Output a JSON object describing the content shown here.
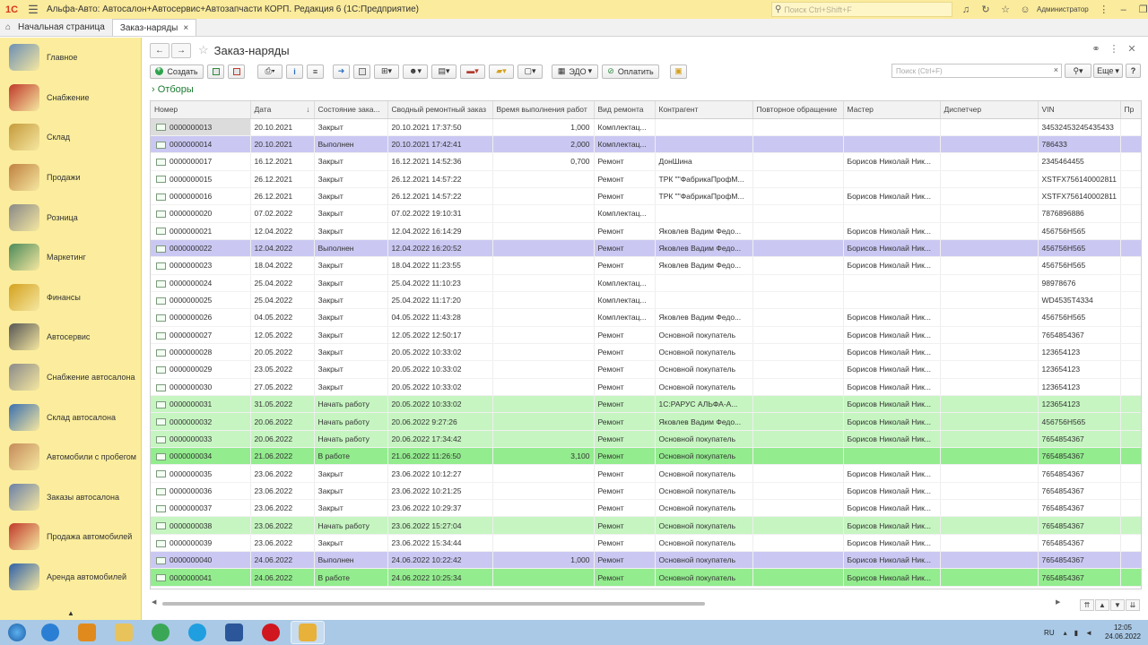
{
  "app": {
    "logo_text": "1С",
    "title": "Альфа-Авто: Автосалон+Автосервис+Автозапчасти КОРП. Редакция 6  (1С:Предприятие)",
    "search_placeholder": "Поиск Ctrl+Shift+F",
    "user": "Администратор"
  },
  "tabs": [
    {
      "label": "Начальная страница"
    },
    {
      "label": "Заказ-наряды",
      "close": "×"
    }
  ],
  "sidebar": {
    "items": [
      {
        "label": "Главное",
        "icon": "main-icon",
        "color": "#6c8fb5"
      },
      {
        "label": "Снабжение",
        "icon": "truck-icon",
        "color": "#c0392b"
      },
      {
        "label": "Склад",
        "icon": "boxes-icon",
        "color": "#c59a3c"
      },
      {
        "label": "Продажи",
        "icon": "sales-icon",
        "color": "#c08040"
      },
      {
        "label": "Розница",
        "icon": "cash-register-icon",
        "color": "#888888"
      },
      {
        "label": "Маркетинг",
        "icon": "chart-icon",
        "color": "#4a8a5a"
      },
      {
        "label": "Финансы",
        "icon": "coins-icon",
        "color": "#d4a11e"
      },
      {
        "label": "Автосервис",
        "icon": "wheel-icon",
        "color": "#555555"
      },
      {
        "label": "Снабжение автосалона",
        "icon": "calculator-icon",
        "color": "#8a8a8a"
      },
      {
        "label": "Склад автосалона",
        "icon": "garage-icon",
        "color": "#3a6fb0"
      },
      {
        "label": "Автомобили с пробегом",
        "icon": "handshake-icon",
        "color": "#c58a5a"
      },
      {
        "label": "Заказы автосалона",
        "icon": "order-icon",
        "color": "#6a7fa8"
      },
      {
        "label": "Продажа автомобилей",
        "icon": "red-car-icon",
        "color": "#c0392b"
      },
      {
        "label": "Аренда автомобилей",
        "icon": "blue-car-icon",
        "color": "#2e5fa8"
      }
    ],
    "collapse": "▲"
  },
  "page": {
    "title": "Заказ-наряды",
    "back": "←",
    "forward": "→",
    "star": "☆"
  },
  "toolbar": {
    "create": "Создать",
    "edo": "ЭДО",
    "pay": "Оплатить",
    "search_placeholder": "Поиск (Ctrl+F)",
    "more": "Еще",
    "help": "?"
  },
  "filters_label": "Отборы",
  "columns": [
    "Номер",
    "Дата",
    "Состояние зака...",
    "Сводный ремонтный заказ",
    "Время выполнения работ",
    "Вид ремонта",
    "Контрагент",
    "Повторное обращение",
    "Мастер",
    "Диспетчер",
    "VIN",
    "Пр"
  ],
  "sort_indicator": "↓",
  "rows": [
    {
      "num": "0000000013",
      "date": "20.10.2021",
      "state": "Закрыт",
      "summary": "20.10.2021 17:37:50",
      "time": "1,000",
      "kind": "Комплектац...",
      "contractor": "",
      "repeat": "",
      "master": "",
      "dispatcher": "",
      "vin": "34532453245435433",
      "status": "closed"
    },
    {
      "num": "0000000014",
      "date": "20.10.2021",
      "state": "Выполнен",
      "summary": "20.10.2021 17:42:41",
      "time": "2,000",
      "kind": "Комплектац...",
      "contractor": "",
      "repeat": "",
      "master": "",
      "dispatcher": "",
      "vin": "786433",
      "status": "done"
    },
    {
      "num": "0000000017",
      "date": "16.12.2021",
      "state": "Закрыт",
      "summary": "16.12.2021 14:52:36",
      "time": "0,700",
      "kind": "Ремонт",
      "contractor": "ДонШина",
      "repeat": "",
      "master": "Борисов Николай Ник...",
      "dispatcher": "",
      "vin": "2345464455",
      "status": "closed"
    },
    {
      "num": "0000000015",
      "date": "26.12.2021",
      "state": "Закрыт",
      "summary": "26.12.2021 14:57:22",
      "time": "",
      "kind": "Ремонт",
      "contractor": "ТРК \"\"ФабрикаПрофМ...",
      "repeat": "",
      "master": "",
      "dispatcher": "",
      "vin": "XSTFX756140002811",
      "status": "closed"
    },
    {
      "num": "0000000016",
      "date": "26.12.2021",
      "state": "Закрыт",
      "summary": "26.12.2021 14:57:22",
      "time": "",
      "kind": "Ремонт",
      "contractor": "ТРК \"\"ФабрикаПрофМ...",
      "repeat": "",
      "master": "Борисов Николай Ник...",
      "dispatcher": "",
      "vin": "XSTFX756140002811",
      "status": "closed"
    },
    {
      "num": "0000000020",
      "date": "07.02.2022",
      "state": "Закрыт",
      "summary": "07.02.2022 19:10:31",
      "time": "",
      "kind": "Комплектац...",
      "contractor": "",
      "repeat": "",
      "master": "",
      "dispatcher": "",
      "vin": "7876896886",
      "status": "closed"
    },
    {
      "num": "0000000021",
      "date": "12.04.2022",
      "state": "Закрыт",
      "summary": "12.04.2022 16:14:29",
      "time": "",
      "kind": "Ремонт",
      "contractor": "Яковлев Вадим Федо...",
      "repeat": "",
      "master": "Борисов Николай Ник...",
      "dispatcher": "",
      "vin": "456756H565",
      "status": "closed"
    },
    {
      "num": "0000000022",
      "date": "12.04.2022",
      "state": "Выполнен",
      "summary": "12.04.2022 16:20:52",
      "time": "",
      "kind": "Ремонт",
      "contractor": "Яковлев Вадим Федо...",
      "repeat": "",
      "master": "Борисов Николай Ник...",
      "dispatcher": "",
      "vin": "456756H565",
      "status": "done"
    },
    {
      "num": "0000000023",
      "date": "18.04.2022",
      "state": "Закрыт",
      "summary": "18.04.2022 11:23:55",
      "time": "",
      "kind": "Ремонт",
      "contractor": "Яковлев Вадим Федо...",
      "repeat": "",
      "master": "Борисов Николай Ник...",
      "dispatcher": "",
      "vin": "456756H565",
      "status": "closed"
    },
    {
      "num": "0000000024",
      "date": "25.04.2022",
      "state": "Закрыт",
      "summary": "25.04.2022 11:10:23",
      "time": "",
      "kind": "Комплектац...",
      "contractor": "",
      "repeat": "",
      "master": "",
      "dispatcher": "",
      "vin": "98978676",
      "status": "closed"
    },
    {
      "num": "0000000025",
      "date": "25.04.2022",
      "state": "Закрыт",
      "summary": "25.04.2022 11:17:20",
      "time": "",
      "kind": "Комплектац...",
      "contractor": "",
      "repeat": "",
      "master": "",
      "dispatcher": "",
      "vin": "WD4535T4334",
      "status": "closed"
    },
    {
      "num": "0000000026",
      "date": "04.05.2022",
      "state": "Закрыт",
      "summary": "04.05.2022 11:43:28",
      "time": "",
      "kind": "Комплектац...",
      "contractor": "Яковлев Вадим Федо...",
      "repeat": "",
      "master": "Борисов Николай Ник...",
      "dispatcher": "",
      "vin": "456756H565",
      "status": "closed"
    },
    {
      "num": "0000000027",
      "date": "12.05.2022",
      "state": "Закрыт",
      "summary": "12.05.2022 12:50:17",
      "time": "",
      "kind": "Ремонт",
      "contractor": "Основной покупатель",
      "repeat": "",
      "master": "Борисов Николай Ник...",
      "dispatcher": "",
      "vin": "7654854367",
      "status": "closed"
    },
    {
      "num": "0000000028",
      "date": "20.05.2022",
      "state": "Закрыт",
      "summary": "20.05.2022 10:33:02",
      "time": "",
      "kind": "Ремонт",
      "contractor": "Основной покупатель",
      "repeat": "",
      "master": "Борисов Николай Ник...",
      "dispatcher": "",
      "vin": "123654123",
      "status": "closed"
    },
    {
      "num": "0000000029",
      "date": "23.05.2022",
      "state": "Закрыт",
      "summary": "20.05.2022 10:33:02",
      "time": "",
      "kind": "Ремонт",
      "contractor": "Основной покупатель",
      "repeat": "",
      "master": "Борисов Николай Ник...",
      "dispatcher": "",
      "vin": "123654123",
      "status": "closed"
    },
    {
      "num": "0000000030",
      "date": "27.05.2022",
      "state": "Закрыт",
      "summary": "20.05.2022 10:33:02",
      "time": "",
      "kind": "Ремонт",
      "contractor": "Основной покупатель",
      "repeat": "",
      "master": "Борисов Николай Ник...",
      "dispatcher": "",
      "vin": "123654123",
      "status": "closed"
    },
    {
      "num": "0000000031",
      "date": "31.05.2022",
      "state": "Начать работу",
      "summary": "20.05.2022 10:33:02",
      "time": "",
      "kind": "Ремонт",
      "contractor": "1С:РАРУС АЛЬФА-А...",
      "repeat": "",
      "master": "Борисов Николай Ник...",
      "dispatcher": "",
      "vin": "123654123",
      "status": "start"
    },
    {
      "num": "0000000032",
      "date": "20.06.2022",
      "state": "Начать работу",
      "summary": "20.06.2022 9:27:26",
      "time": "",
      "kind": "Ремонт",
      "contractor": "Яковлев Вадим Федо...",
      "repeat": "",
      "master": "Борисов Николай Ник...",
      "dispatcher": "",
      "vin": "456756H565",
      "status": "start"
    },
    {
      "num": "0000000033",
      "date": "20.06.2022",
      "state": "Начать работу",
      "summary": "20.06.2022 17:34:42",
      "time": "",
      "kind": "Ремонт",
      "contractor": "Основной покупатель",
      "repeat": "",
      "master": "Борисов Николай Ник...",
      "dispatcher": "",
      "vin": "7654854367",
      "status": "start"
    },
    {
      "num": "0000000034",
      "date": "21.06.2022",
      "state": "В работе",
      "summary": "21.06.2022 11:26:50",
      "time": "3,100",
      "kind": "Ремонт",
      "contractor": "Основной покупатель",
      "repeat": "",
      "master": "",
      "dispatcher": "",
      "vin": "7654854367",
      "status": "work"
    },
    {
      "num": "0000000035",
      "date": "23.06.2022",
      "state": "Закрыт",
      "summary": "23.06.2022 10:12:27",
      "time": "",
      "kind": "Ремонт",
      "contractor": "Основной покупатель",
      "repeat": "",
      "master": "Борисов Николай Ник...",
      "dispatcher": "",
      "vin": "7654854367",
      "status": "closed"
    },
    {
      "num": "0000000036",
      "date": "23.06.2022",
      "state": "Закрыт",
      "summary": "23.06.2022 10:21:25",
      "time": "",
      "kind": "Ремонт",
      "contractor": "Основной покупатель",
      "repeat": "",
      "master": "Борисов Николай Ник...",
      "dispatcher": "",
      "vin": "7654854367",
      "status": "closed"
    },
    {
      "num": "0000000037",
      "date": "23.06.2022",
      "state": "Закрыт",
      "summary": "23.06.2022 10:29:37",
      "time": "",
      "kind": "Ремонт",
      "contractor": "Основной покупатель",
      "repeat": "",
      "master": "Борисов Николай Ник...",
      "dispatcher": "",
      "vin": "7654854367",
      "status": "closed"
    },
    {
      "num": "0000000038",
      "date": "23.06.2022",
      "state": "Начать работу",
      "summary": "23.06.2022 15:27:04",
      "time": "",
      "kind": "Ремонт",
      "contractor": "Основной покупатель",
      "repeat": "",
      "master": "Борисов Николай Ник...",
      "dispatcher": "",
      "vin": "7654854367",
      "status": "start"
    },
    {
      "num": "0000000039",
      "date": "23.06.2022",
      "state": "Закрыт",
      "summary": "23.06.2022 15:34:44",
      "time": "",
      "kind": "Ремонт",
      "contractor": "Основной покупатель",
      "repeat": "",
      "master": "Борисов Николай Ник...",
      "dispatcher": "",
      "vin": "7654854367",
      "status": "closed"
    },
    {
      "num": "0000000040",
      "date": "24.06.2022",
      "state": "Выполнен",
      "summary": "24.06.2022 10:22:42",
      "time": "1,000",
      "kind": "Ремонт",
      "contractor": "Основной покупатель",
      "repeat": "",
      "master": "Борисов Николай Ник...",
      "dispatcher": "",
      "vin": "7654854367",
      "status": "done"
    },
    {
      "num": "0000000041",
      "date": "24.06.2022",
      "state": "В работе",
      "summary": "24.06.2022 10:25:34",
      "time": "",
      "kind": "Ремонт",
      "contractor": "Основной покупатель",
      "repeat": "",
      "master": "Борисов Николай Ник...",
      "dispatcher": "",
      "vin": "7654854367",
      "status": "work"
    }
  ],
  "selected_row": 0,
  "status_colors": {
    "closed": "#ffffff",
    "done": "#cac8f2",
    "start": "#c6f5c1",
    "work": "#93ec8e"
  },
  "taskbar": {
    "apps": [
      {
        "name": "ie-icon",
        "color": "#2a7fd4"
      },
      {
        "name": "media-player-icon",
        "color": "#e08a1e"
      },
      {
        "name": "explorer-folder-icon",
        "color": "#e8c25a"
      },
      {
        "name": "chrome-icon",
        "color": "#3aa757"
      },
      {
        "name": "skype-icon",
        "color": "#1f9ee0"
      },
      {
        "name": "word-icon",
        "color": "#2b579a"
      },
      {
        "name": "opera-icon",
        "color": "#d0161f"
      },
      {
        "name": "1c-enterprise-icon",
        "color": "#e8b13a"
      }
    ],
    "lang": "RU",
    "time": "12:05",
    "date": "24.06.2022"
  }
}
